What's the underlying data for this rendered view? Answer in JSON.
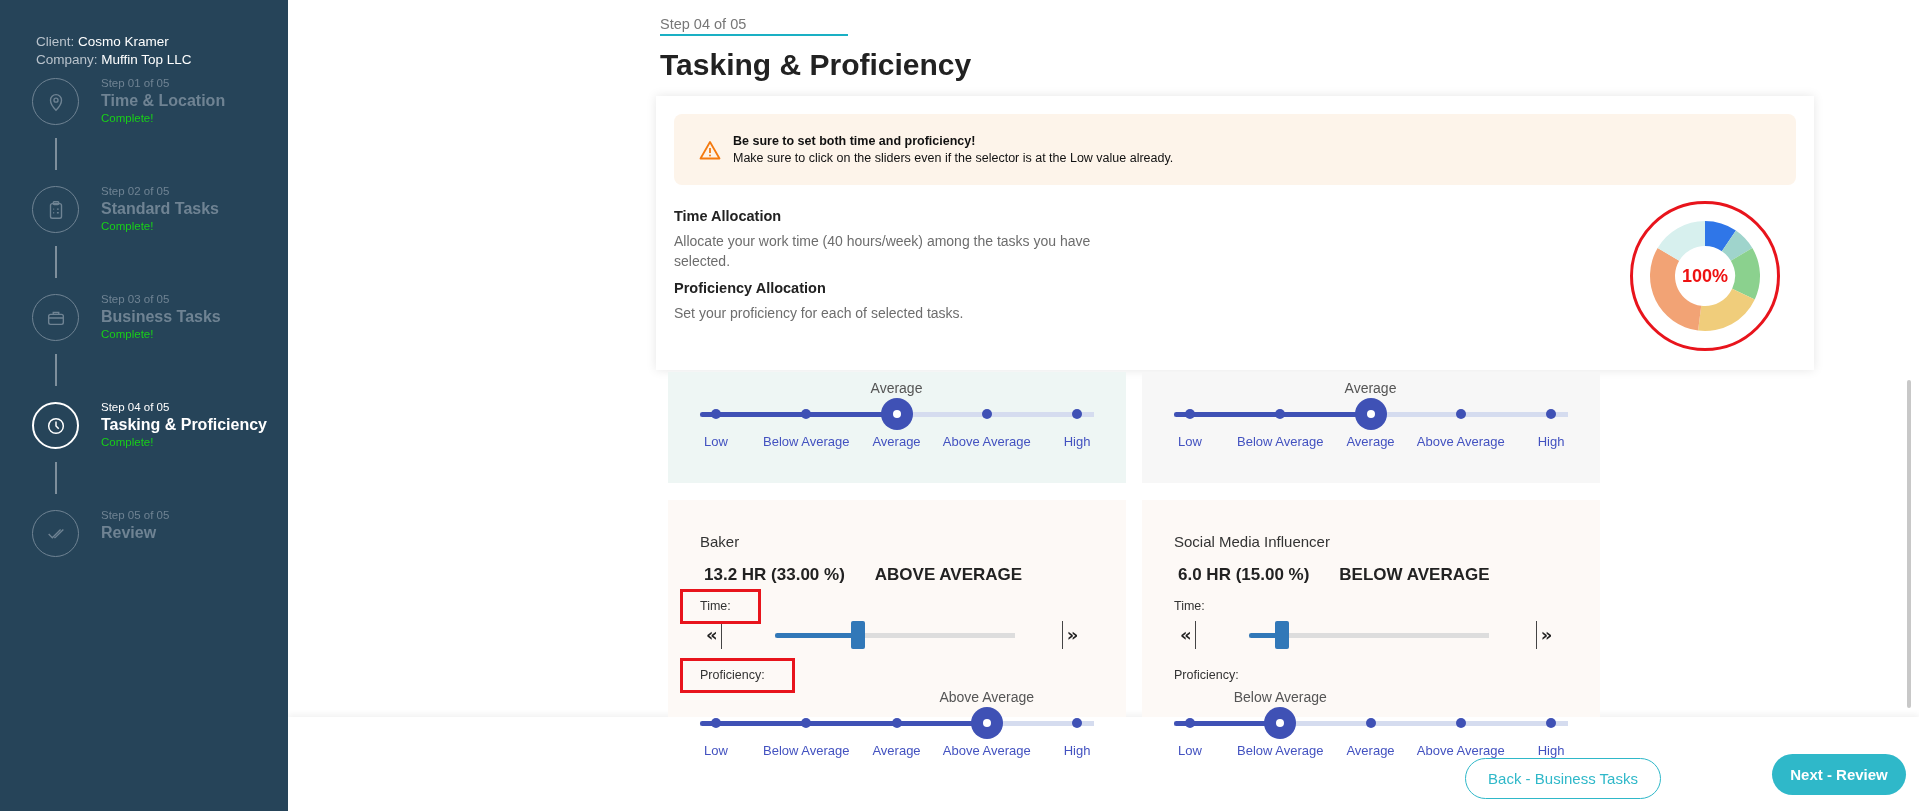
{
  "sidebar": {
    "client_label": "Client:",
    "client": "Cosmo Kramer",
    "company_label": "Company:",
    "company": "Muffin Top LLC",
    "steps": [
      {
        "step": "Step 01 of 05",
        "title": "Time & Location",
        "status": "Complete!",
        "selected": false
      },
      {
        "step": "Step 02 of 05",
        "title": "Standard Tasks",
        "status": "Complete!",
        "selected": false
      },
      {
        "step": "Step 03 of 05",
        "title": "Business Tasks",
        "status": "Complete!",
        "selected": false
      },
      {
        "step": "Step 04 of 05",
        "title": "Tasking & Proficiency",
        "status": "Complete!",
        "selected": true
      },
      {
        "step": "Step 05 of 05",
        "title": "Review",
        "selected": false
      }
    ]
  },
  "header": {
    "step": "Step 04 of 05",
    "title": "Tasking & Proficiency"
  },
  "panel": {
    "alert_title": "Be sure to set both time and proficiency!",
    "alert_text": "Make sure to click on the sliders even if the selector is at the Low value already.",
    "sections": [
      {
        "heading": "Time Allocation",
        "text": "Allocate your work time (40 hours/week) among the tasks you have selected."
      },
      {
        "heading": "Proficiency Allocation",
        "text": "Set your proficiency for each of selected tasks."
      }
    ],
    "donut_label": "100%",
    "donut_annotated": true
  },
  "tasks": [
    {
      "color": "#eef6f4",
      "proficiency": {
        "value_label": "Average",
        "level": 0.5,
        "ticks": [
          "Low",
          "Below Average",
          "Average",
          "Above Average",
          "High"
        ]
      }
    },
    {
      "color": "#f7f7f7",
      "proficiency": {
        "value_label": "Average",
        "level": 0.5,
        "ticks": [
          "Low",
          "Below Average",
          "Average",
          "Above Average",
          "High"
        ]
      }
    },
    {
      "color": "#fdf9f6",
      "name": "Baker",
      "hours": "13.2 HR (33.00 %)",
      "rating": "ABOVE AVERAGE",
      "time": {
        "label": "Time:",
        "prev": "«",
        "next": "»",
        "level": 0.33
      },
      "proficiency_label": "Proficiency:",
      "annotated": true,
      "proficiency": {
        "value_label": "Above Average",
        "level": 0.75,
        "ticks": [
          "Low",
          "Below Average",
          "Average",
          "Above Average",
          "High"
        ]
      }
    },
    {
      "color": "#fdf9f6",
      "name": "Social Media Influencer",
      "hours": "6.0 HR (15.00 %)",
      "rating": "BELOW AVERAGE",
      "time": {
        "label": "Time:",
        "prev": "«",
        "next": "»",
        "level": 0.13
      },
      "proficiency_label": "Proficiency:",
      "annotated": false,
      "proficiency": {
        "value_label": "Below Average",
        "level": 0.25,
        "ticks": [
          "Low",
          "Below Average",
          "Average",
          "Above Average",
          "High"
        ]
      }
    }
  ],
  "footer": {
    "back": "Back - Business Tasks",
    "next": "Next - Review"
  }
}
